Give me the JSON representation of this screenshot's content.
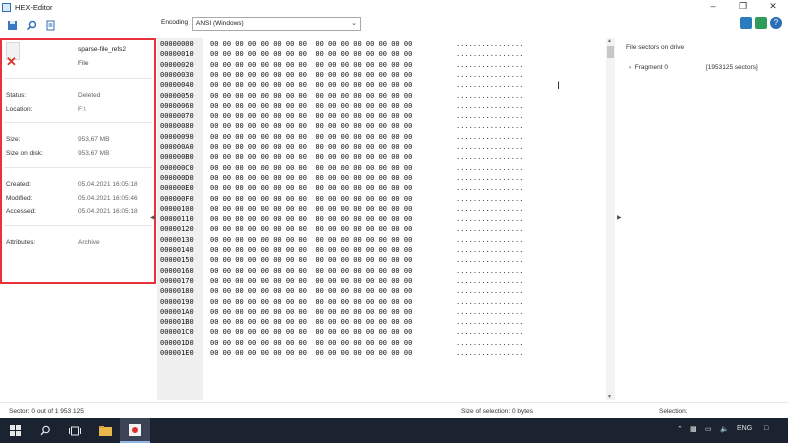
{
  "window": {
    "title": "HEX-Editor"
  },
  "toolbar": {
    "encoding_label": "Encoding",
    "encoding_value": "ANSI (Windows)"
  },
  "properties": {
    "file_name": "sparse-file_refs2",
    "file_type": "File",
    "status_label": "Status:",
    "status_value": "Deleted",
    "location_label": "Location:",
    "location_value": "F:\\",
    "size_label": "Size:",
    "size_value": "953,67 MB",
    "size_on_disk_label": "Size on disk:",
    "size_on_disk_value": "953,67 MB",
    "created_label": "Created:",
    "created_value": "05.04.2021 16:05:18",
    "modified_label": "Modified:",
    "modified_value": "05.04.2021 16:05:46",
    "accessed_label": "Accessed:",
    "accessed_value": "05.04.2021 16:05:18",
    "attributes_label": "Attributes:",
    "attributes_value": "Archive"
  },
  "hex": {
    "offsets": [
      "00000000",
      "00000010",
      "00000020",
      "00000030",
      "00000040",
      "00000050",
      "00000060",
      "00000070",
      "00000080",
      "00000090",
      "000000A0",
      "000000B0",
      "000000C0",
      "000000D0",
      "000000E0",
      "000000F0",
      "00000100",
      "00000110",
      "00000120",
      "00000130",
      "00000140",
      "00000150",
      "00000160",
      "00000170",
      "00000180",
      "00000190",
      "000001A0",
      "000001B0",
      "000001C0",
      "000001D0",
      "000001E0"
    ],
    "row_bytes": "00 00 00 00 00 00 00 00  00 00 00 00 00 00 00 00",
    "row_ascii": "................"
  },
  "sectors_panel": {
    "title": "File sectors on drive",
    "fragment_label": "Fragment 0",
    "fragment_sectors": "[1953125 sectors]"
  },
  "status": {
    "sector": "Sector: 0 out of 1 953 125",
    "size_of_selection": "Size of selection: 0 bytes",
    "selection": "Selection:"
  },
  "taskbar": {
    "language": "ENG"
  }
}
